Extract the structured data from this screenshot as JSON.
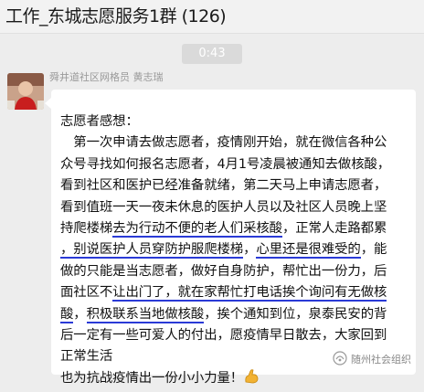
{
  "header": {
    "title": "工作_东城志愿服务1群 (126)"
  },
  "chat": {
    "timestamp": "0:43",
    "sender": "舜井道社区网格员 黄志瑞",
    "message": {
      "lines": [
        [
          "志愿者感想："
        ],
        [
          "　第一次申请去做志愿者，疫情刚开始，就在微信各种公"
        ],
        [
          "众号寻找如何报名志愿者，4月1号凌晨被通知去做核酸，"
        ],
        [
          "看到社区和医护已经准备就绪，第二天马上申请志愿者，"
        ],
        [
          "看到值班一天一夜未休息的医护人员以及社区人员晚上坚"
        ],
        [
          "持爬楼梯",
          "去为行动不便的老人们采核酸",
          "，正常人走路都累"
        ],
        [
          "，别说医护人员穿防护服爬楼梯",
          "，",
          "心里还是很难受的",
          "，能"
        ],
        [
          "做的只能是当志愿者，做好自身防护，帮忙出一份力，后"
        ],
        [
          "面社区不",
          "让出门了，就在家帮忙打电话挨个询问有无做核",
          ""
        ],
        [
          "酸",
          "，",
          "积极联系当地做核酸",
          "，挨个通知到位，泉泰民安的背"
        ],
        [
          "后一定有一些可爱人的付出，愿疫情早日散去，大家回到"
        ],
        [
          "正常生活"
        ],
        [
          "也为抗战疫情出一份小小力量！"
        ]
      ]
    }
  },
  "watermark": {
    "text": "随州社会组织"
  }
}
